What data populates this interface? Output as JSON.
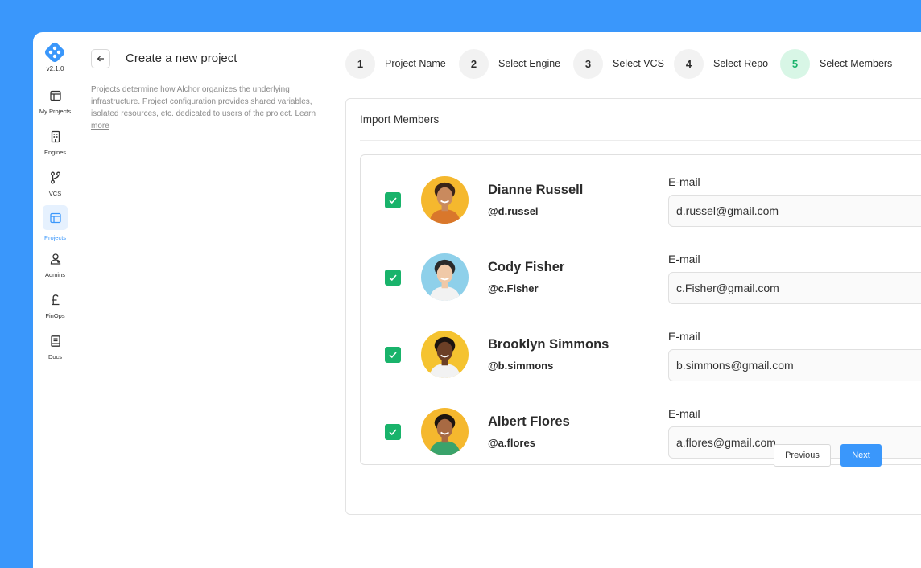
{
  "app": {
    "version": "v2.1.0"
  },
  "sidebar": {
    "items": [
      {
        "label": "My Projects",
        "icon": "layout-icon"
      },
      {
        "label": "Engines",
        "icon": "building-icon"
      },
      {
        "label": "VCS",
        "icon": "branch-icon"
      },
      {
        "label": "Projects",
        "icon": "layout-icon",
        "active": true
      },
      {
        "label": "Admins",
        "icon": "admin-icon"
      },
      {
        "label": "FinOps",
        "icon": "pound-icon"
      },
      {
        "label": "Docs",
        "icon": "book-icon"
      }
    ]
  },
  "header": {
    "title": "Create a new project",
    "description": "Projects determine how Alchor organizes the underlying infrastructure.  Project configuration provides shared variables, isolated resources,  etc. dedicated to users of the project.",
    "learn_more": " Learn more"
  },
  "stepper": {
    "steps": [
      {
        "number": "1",
        "label": "Project Name"
      },
      {
        "number": "2",
        "label": "Select Engine"
      },
      {
        "number": "3",
        "label": "Select VCS"
      },
      {
        "number": "4",
        "label": "Select Repo"
      },
      {
        "number": "5",
        "label": "Select Members",
        "active": true
      }
    ]
  },
  "panel": {
    "title": "Import Members",
    "email_label": "E-mail",
    "members": [
      {
        "name": "Dianne Russell",
        "handle": "@d.russel",
        "email": "d.russel@gmail.com",
        "checked": true,
        "avatar_bg": "#f5b82e",
        "skin": "#c98a5e",
        "hair": "#3a2418",
        "shirt": "#d9772b"
      },
      {
        "name": "Cody Fisher",
        "handle": "@c.Fisher",
        "email": "c.Fisher@gmail.com",
        "checked": true,
        "avatar_bg": "#8ed0ea",
        "skin": "#f0c9a8",
        "hair": "#2a2a2a",
        "shirt": "#f2f2f2"
      },
      {
        "name": "Brooklyn Simmons",
        "handle": "@b.simmons",
        "email": "b.simmons@gmail.com",
        "checked": true,
        "avatar_bg": "#f5c330",
        "skin": "#6b3f26",
        "hair": "#1c1410",
        "shirt": "#f2f2f2"
      },
      {
        "name": "Albert Flores",
        "handle": "@a.flores",
        "email": "a.flores@gmail.com",
        "checked": true,
        "avatar_bg": "#f5b82e",
        "skin": "#a86a43",
        "hair": "#1c1410",
        "shirt": "#3aa36b"
      }
    ]
  },
  "actions": {
    "previous": "Previous",
    "next": "Next"
  },
  "colors": {
    "accent": "#3a97fb",
    "success": "#19b36b"
  }
}
